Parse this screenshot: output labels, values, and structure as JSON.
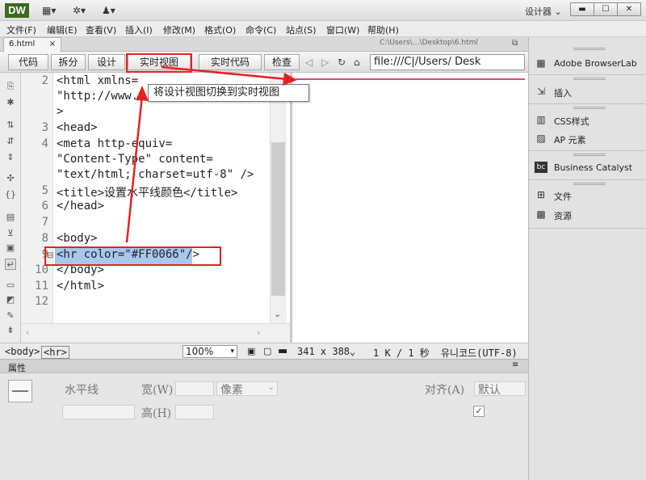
{
  "app": {
    "logo": "DW",
    "workspace": "设计器 ⌄"
  },
  "menu": [
    "文件(F)",
    "编辑(E)",
    "查看(V)",
    "插入(I)",
    "修改(M)",
    "格式(O)",
    "命令(C)",
    "站点(S)",
    "窗口(W)",
    "帮助(H)"
  ],
  "doc_tab": {
    "name": "6.html",
    "close": "×"
  },
  "path_label": "C:\\Users\\…\\Desktop\\6.html",
  "view_buttons": {
    "code": "代码",
    "split": "拆分",
    "design": "设计",
    "live_view": "实时视图",
    "live_code": "实时代码",
    "inspect": "检查"
  },
  "address": "file:///C|/Users/ Desk",
  "line_numbers": [
    "2",
    "3",
    "4",
    "5",
    "6",
    "7",
    "8",
    "9",
    "10",
    "11",
    "12"
  ],
  "code_lines": [
    "<html xmlns=",
    "\"http://www.",
    ">",
    "<head>",
    "<meta http-equiv=",
    "\"Content-Type\" content=",
    "\"text/html; charset=utf-8\" />",
    "<title>设置水平线颜色</title>",
    "</head>",
    "",
    "<body>",
    "<hr color=\"#FF0066\"/>",
    "</body>",
    "</html>"
  ],
  "tooltip": "将设计视图切换到实时视图",
  "status": {
    "tag1": "<body>",
    "tag2": "<hr>",
    "zoom": "100%",
    "size": "341 x 388⌄",
    "filesize": "1 K / 1 秒",
    "encoding": "유니코드(UTF-8)"
  },
  "properties": {
    "title": "属性",
    "element": "水平线",
    "width_label": "宽(W)",
    "height_label": "高(H)",
    "unit": "像素",
    "align_label": "对齐(A)",
    "align_value": "默认"
  },
  "right_panel": {
    "browserlab": "Adobe BrowserLab",
    "insert": "插入",
    "css": "CSS样式",
    "ap": "AP 元素",
    "bc": "Business Catalyst",
    "files": "文件",
    "assets": "资源"
  },
  "colors": {
    "hr_color": "#FF0066",
    "annotation": "#E52222",
    "selection": "#A9C8F0"
  }
}
